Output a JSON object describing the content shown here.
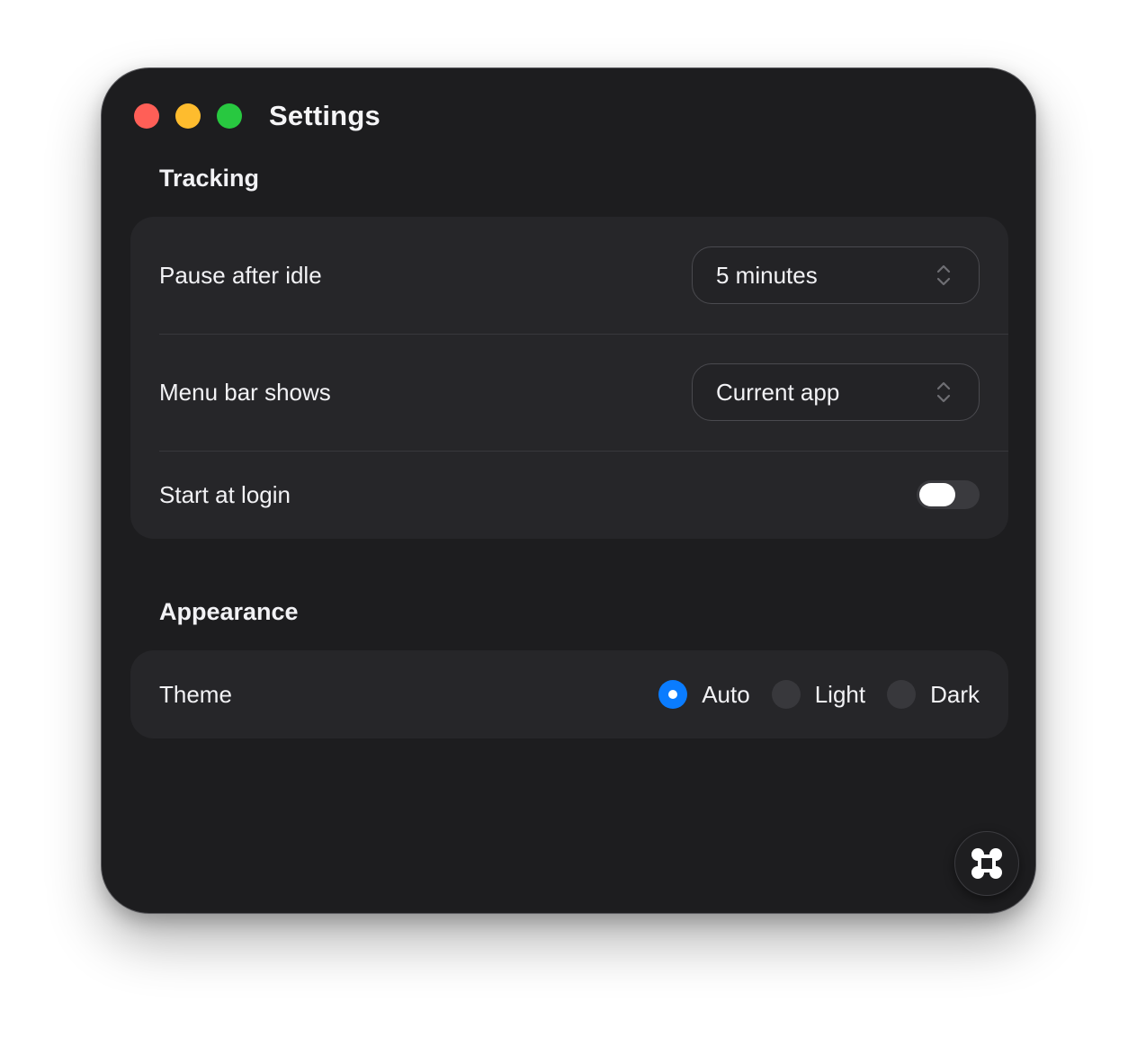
{
  "window": {
    "title": "Settings"
  },
  "tracking": {
    "section_title": "Tracking",
    "pause_after_idle": {
      "label": "Pause after idle",
      "value": "5 minutes"
    },
    "menu_bar_shows": {
      "label": "Menu bar shows",
      "value": "Current app"
    },
    "start_at_login": {
      "label": "Start at login",
      "enabled": false
    }
  },
  "appearance": {
    "section_title": "Appearance",
    "theme": {
      "label": "Theme",
      "selected": "Auto",
      "options": [
        "Auto",
        "Light",
        "Dark"
      ]
    }
  },
  "icons": {
    "close": "red-close-dot",
    "minimize": "yellow-minimize-dot",
    "zoom": "green-zoom-dot",
    "select": "chevron-up-down-icon",
    "fab": "command-key-icon"
  },
  "colors": {
    "window_bg": "#1d1d1f",
    "card_bg": "#262629",
    "accent": "#0a7cff",
    "close": "#ff5f57",
    "minimize": "#febc2e",
    "zoom": "#28c840"
  }
}
